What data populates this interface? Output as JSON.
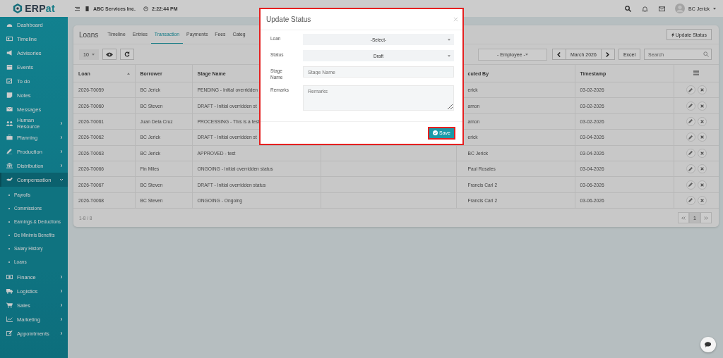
{
  "logo": {
    "main": "ERP",
    "accent": "at"
  },
  "header": {
    "company": "ABC Services Inc.",
    "time": "2:22:44 PM",
    "user": "BC Jerick"
  },
  "sidebar": {
    "items": [
      {
        "label": "Dashboard",
        "has_submenu": false,
        "selected": false
      },
      {
        "label": "Timeline",
        "has_submenu": false,
        "selected": false
      },
      {
        "label": "Advisories",
        "has_submenu": false,
        "selected": false
      },
      {
        "label": "Events",
        "has_submenu": false,
        "selected": false
      },
      {
        "label": "To do",
        "has_submenu": false,
        "selected": false
      },
      {
        "label": "Notes",
        "has_submenu": false,
        "selected": false
      },
      {
        "label": "Messages",
        "has_submenu": false,
        "selected": false
      },
      {
        "label": "Human Resource",
        "has_submenu": true,
        "expanded": false,
        "selected": false
      },
      {
        "label": "Planning",
        "has_submenu": true,
        "expanded": false,
        "selected": false
      },
      {
        "label": "Production",
        "has_submenu": true,
        "expanded": false,
        "selected": false
      },
      {
        "label": "Distribution",
        "has_submenu": true,
        "expanded": false,
        "selected": false
      },
      {
        "label": "Compensation",
        "has_submenu": true,
        "expanded": true,
        "selected": true,
        "children": [
          {
            "label": "Payrolls"
          },
          {
            "label": "Commissions"
          },
          {
            "label": "Earnings & Deductions"
          },
          {
            "label": "De Minimis Benefits"
          },
          {
            "label": "Salary History"
          },
          {
            "label": "Loans"
          }
        ]
      },
      {
        "label": "Finance",
        "has_submenu": true,
        "expanded": false,
        "selected": false
      },
      {
        "label": "Logistics",
        "has_submenu": true,
        "expanded": false,
        "selected": false
      },
      {
        "label": "Sales",
        "has_submenu": true,
        "expanded": false,
        "selected": false
      },
      {
        "label": "Marketing",
        "has_submenu": true,
        "expanded": false,
        "selected": false
      },
      {
        "label": "Appointments",
        "has_submenu": true,
        "expanded": false,
        "selected": false
      }
    ]
  },
  "page": {
    "title": "Loans",
    "tabs": [
      {
        "label": "Timeline",
        "selected": false
      },
      {
        "label": "Entries",
        "selected": false
      },
      {
        "label": "Transaction",
        "selected": true
      },
      {
        "label": "Payments",
        "selected": false
      },
      {
        "label": "Fees",
        "selected": false
      },
      {
        "label": "Categ",
        "selected": false
      }
    ],
    "update_button": "Update Status",
    "page_size": "10",
    "employee_filter": "- Employee -",
    "month": "March 2026",
    "excel_button": "Excel",
    "search_placeholder": "Search"
  },
  "table": {
    "columns": [
      {
        "kind": "text",
        "label": "Loan",
        "sorted": true
      },
      {
        "kind": "text",
        "label": "Borrower",
        "sorted": false
      },
      {
        "kind": "text",
        "label": "Stage Name",
        "sorted": false
      },
      {
        "kind": "blank"
      },
      {
        "kind": "text",
        "label": "cuted By",
        "sorted": false
      },
      {
        "kind": "text",
        "label": "Timestamp",
        "sorted": false
      },
      {
        "kind": "menu"
      }
    ],
    "rows": [
      {
        "loan": "2026-T0059",
        "borrower": "BC Jerick",
        "stage_name": "PENDING - Initial overridden",
        "executed_by": "erick",
        "timestamp": "03-02-2026"
      },
      {
        "loan": "2026-T0060",
        "borrower": "BC Steven",
        "stage_name": "DRAFT - Initial overridden st",
        "executed_by": "amon",
        "timestamp": "03-02-2026"
      },
      {
        "loan": "2026-T0061",
        "borrower": "Juan Dela Cruz",
        "stage_name": "PROCESSING - This is a test",
        "executed_by": "amon",
        "timestamp": "03-02-2026"
      },
      {
        "loan": "2026-T0062",
        "borrower": "BC Jerick",
        "stage_name": "DRAFT - Initial overridden st",
        "executed_by": "erick",
        "timestamp": "03-04-2026"
      },
      {
        "loan": "2026-T0063",
        "borrower": "BC Jerick",
        "stage_name": "APPROVED - test",
        "executed_by": "BC Jerick",
        "timestamp": "03-04-2026"
      },
      {
        "loan": "2026-T0066",
        "borrower": "Fin Miles",
        "stage_name": "ONGOING - Initial overridden status",
        "executed_by": "Paul Rosales",
        "timestamp": "03-04-2026"
      },
      {
        "loan": "2026-T0067",
        "borrower": "BC Steven",
        "stage_name": "DRAFT - Initial overridden status",
        "executed_by": "Francis Carl 2",
        "timestamp": "03-06-2026"
      },
      {
        "loan": "2026-T0068",
        "borrower": "BC Steven",
        "stage_name": "ONGOING - Ongoing",
        "executed_by": "Francis Carl 2",
        "timestamp": "03-06-2026"
      }
    ]
  },
  "pagination": {
    "summary": "1-8 / 8",
    "pages": [
      {
        "label": "1",
        "selected": true
      }
    ]
  },
  "modal": {
    "title": "Update Status",
    "highlighted": true,
    "fields": [
      {
        "kind": "select",
        "label": "Loan",
        "value": "-Select-"
      },
      {
        "kind": "select",
        "label": "Status",
        "value": "Draft"
      },
      {
        "kind": "text",
        "label": "Stage Name",
        "placeholder": "Stage Name"
      },
      {
        "kind": "textarea",
        "label": "Remarks",
        "placeholder": "Remarks"
      }
    ],
    "save_button": {
      "label": "Save",
      "highlighted": true
    }
  }
}
